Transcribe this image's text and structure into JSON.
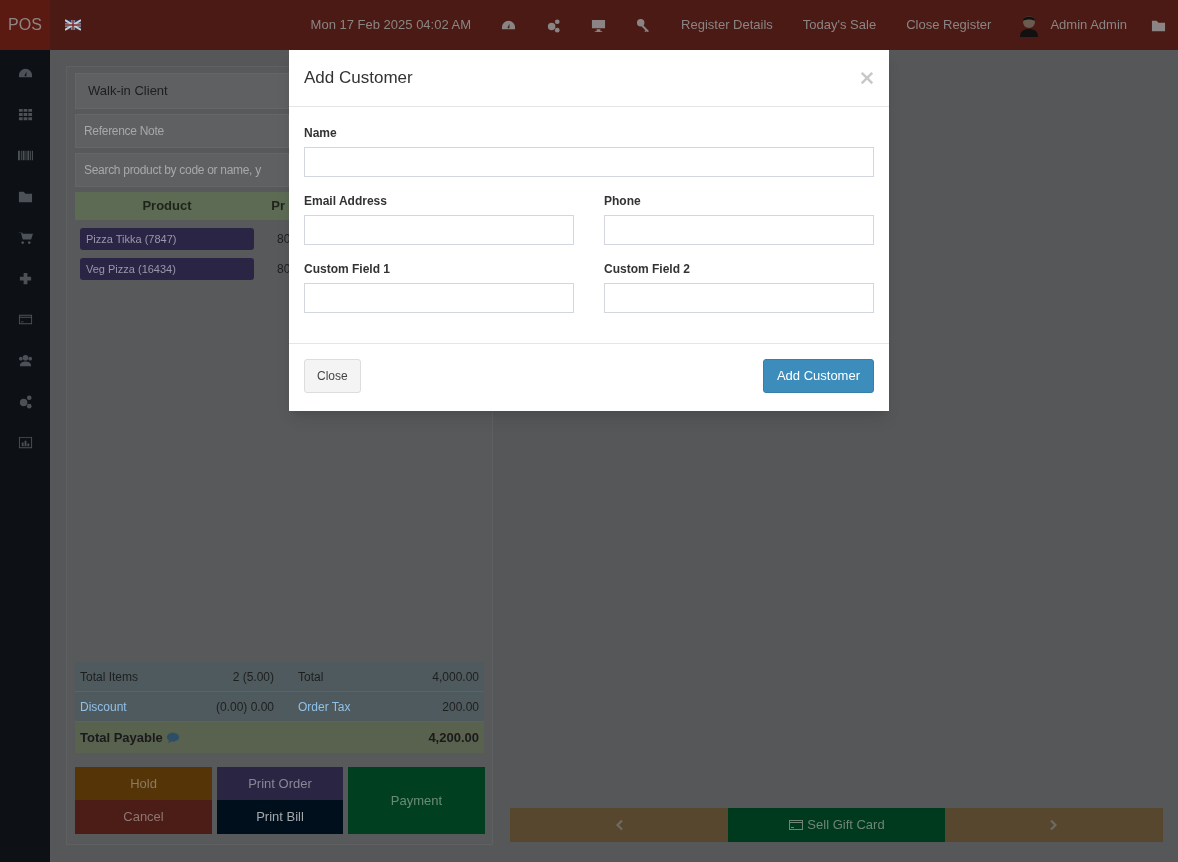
{
  "header": {
    "brand": "POS",
    "date": "Mon 17 Feb 2025 04:02 AM",
    "links": [
      "Register Details",
      "Today's Sale",
      "Close Register"
    ],
    "user": "Admin Admin"
  },
  "customer": {
    "value": "Walk-in Client"
  },
  "reference": {
    "placeholder": "Reference Note"
  },
  "search": {
    "placeholder": "Search product by code or name, y"
  },
  "table": {
    "columns": [
      "Product",
      "Pr"
    ],
    "rows": [
      {
        "product": "Pizza Tikka (7847)",
        "price": "80"
      },
      {
        "product": "Veg Pizza (16434)",
        "price": "80"
      }
    ]
  },
  "totals": [
    {
      "label": "Total Items",
      "value": "2 (5.00)",
      "label_2": "Total",
      "value_2": "4,000.00",
      "kind": "plain"
    },
    {
      "label": "Discount",
      "value": "(0.00) 0.00",
      "label_2": "Order Tax",
      "value_2": "200.00",
      "kind": "link"
    }
  ],
  "payable": {
    "label": "Total Payable",
    "value": "4,200.00"
  },
  "actions": [
    {
      "label": "Hold",
      "kind": "hold"
    },
    {
      "label": "Cancel",
      "kind": "cancel"
    },
    {
      "label": "Print Order",
      "kind": "order"
    },
    {
      "label": "Print Bill",
      "kind": "bill"
    },
    {
      "label": "Payment",
      "kind": "payment"
    }
  ],
  "bottom_bar": {
    "label": "Sell Gift Card"
  },
  "modal": {
    "title": "Add Customer",
    "fields": [
      {
        "label": "Name",
        "kind": "full"
      },
      {
        "label": "Email Address",
        "kind": "half"
      },
      {
        "label": "Phone",
        "kind": "half"
      },
      {
        "label": "Custom Field 1",
        "kind": "half"
      },
      {
        "label": "Custom Field 2",
        "kind": "half"
      }
    ],
    "close_button": "Close",
    "submit_button": "Add Customer"
  }
}
